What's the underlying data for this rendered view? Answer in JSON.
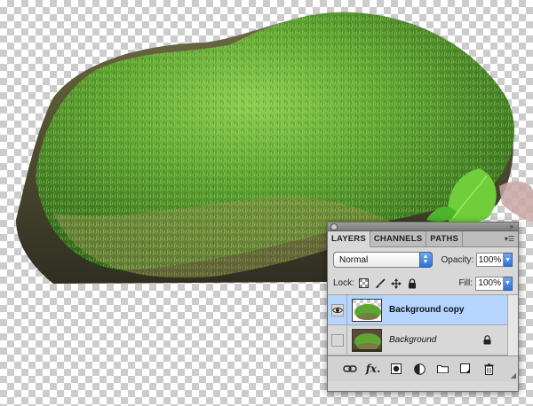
{
  "panel": {
    "tabs": [
      {
        "label": "LAYERS"
      },
      {
        "label": "CHANNELS"
      },
      {
        "label": "PATHS"
      }
    ],
    "blend_mode": "Normal",
    "opacity_label": "Opacity:",
    "opacity_value": "100%",
    "lock_label": "Lock:",
    "fill_label": "Fill:",
    "fill_value": "100%",
    "layers": [
      {
        "name": "Background copy",
        "visible": true,
        "selected": true
      },
      {
        "name": "Background",
        "visible": false,
        "selected": false,
        "locked": true
      }
    ],
    "footer_icons": [
      "link-icon",
      "fx-icon",
      "mask-icon",
      "adjustment-icon",
      "folder-icon",
      "new-layer-icon",
      "trash-icon"
    ]
  },
  "colors": {
    "selection": "#b5d5ff",
    "moss_light": "#7fc44a",
    "moss_dark": "#3f7a22"
  }
}
